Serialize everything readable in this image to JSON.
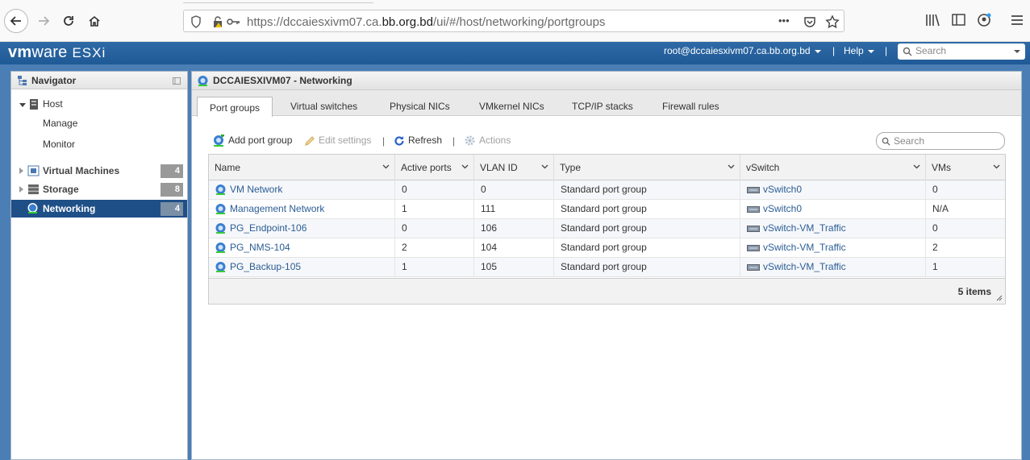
{
  "browser": {
    "url_prefix": "https://dccaiesxivm07.ca.",
    "url_domain": "bb.org.bd",
    "url_path": "/ui/#/host/networking/portgroups",
    "more_label": "•••"
  },
  "header": {
    "brand_vm": "vm",
    "brand_ware": "ware",
    "brand_product": "ESXi",
    "user": "root@dccaiesxivm07.ca.bb.org.bd",
    "help": "Help",
    "search_placeholder": "Search"
  },
  "navigator": {
    "title": "Navigator",
    "items": [
      {
        "label": "Host"
      },
      {
        "label": "Manage"
      },
      {
        "label": "Monitor"
      },
      {
        "label": "Virtual Machines",
        "count": "4"
      },
      {
        "label": "Storage",
        "count": "8"
      },
      {
        "label": "Networking",
        "count": "4"
      }
    ]
  },
  "panel": {
    "title": "DCCAIESXIVM07 - Networking",
    "tabs": [
      {
        "label": "Port groups"
      },
      {
        "label": "Virtual switches"
      },
      {
        "label": "Physical NICs"
      },
      {
        "label": "VMkernel NICs"
      },
      {
        "label": "TCP/IP stacks"
      },
      {
        "label": "Firewall rules"
      }
    ]
  },
  "toolbar": {
    "add": "Add port group",
    "edit": "Edit settings",
    "refresh": "Refresh",
    "actions": "Actions",
    "search_placeholder": "Search"
  },
  "grid": {
    "columns": [
      "Name",
      "Active ports",
      "VLAN ID",
      "Type",
      "vSwitch",
      "VMs"
    ],
    "rows": [
      {
        "name": "VM Network",
        "active_ports": "0",
        "vlan": "0",
        "type": "Standard port group",
        "vswitch": "vSwitch0",
        "vms": "0"
      },
      {
        "name": "Management Network",
        "active_ports": "1",
        "vlan": "111",
        "type": "Standard port group",
        "vswitch": "vSwitch0",
        "vms": "N/A"
      },
      {
        "name": "PG_Endpoint-106",
        "active_ports": "0",
        "vlan": "106",
        "type": "Standard port group",
        "vswitch": "vSwitch-VM_Traffic",
        "vms": "0"
      },
      {
        "name": "PG_NMS-104",
        "active_ports": "2",
        "vlan": "104",
        "type": "Standard port group",
        "vswitch": "vSwitch-VM_Traffic",
        "vms": "2"
      },
      {
        "name": "PG_Backup-105",
        "active_ports": "1",
        "vlan": "105",
        "type": "Standard port group",
        "vswitch": "vSwitch-VM_Traffic",
        "vms": "1"
      }
    ],
    "footer": "5 items"
  },
  "colors": {
    "header_blue": "#2f6aa6",
    "nav_active": "#1f4f87",
    "link": "#2a5d94"
  }
}
